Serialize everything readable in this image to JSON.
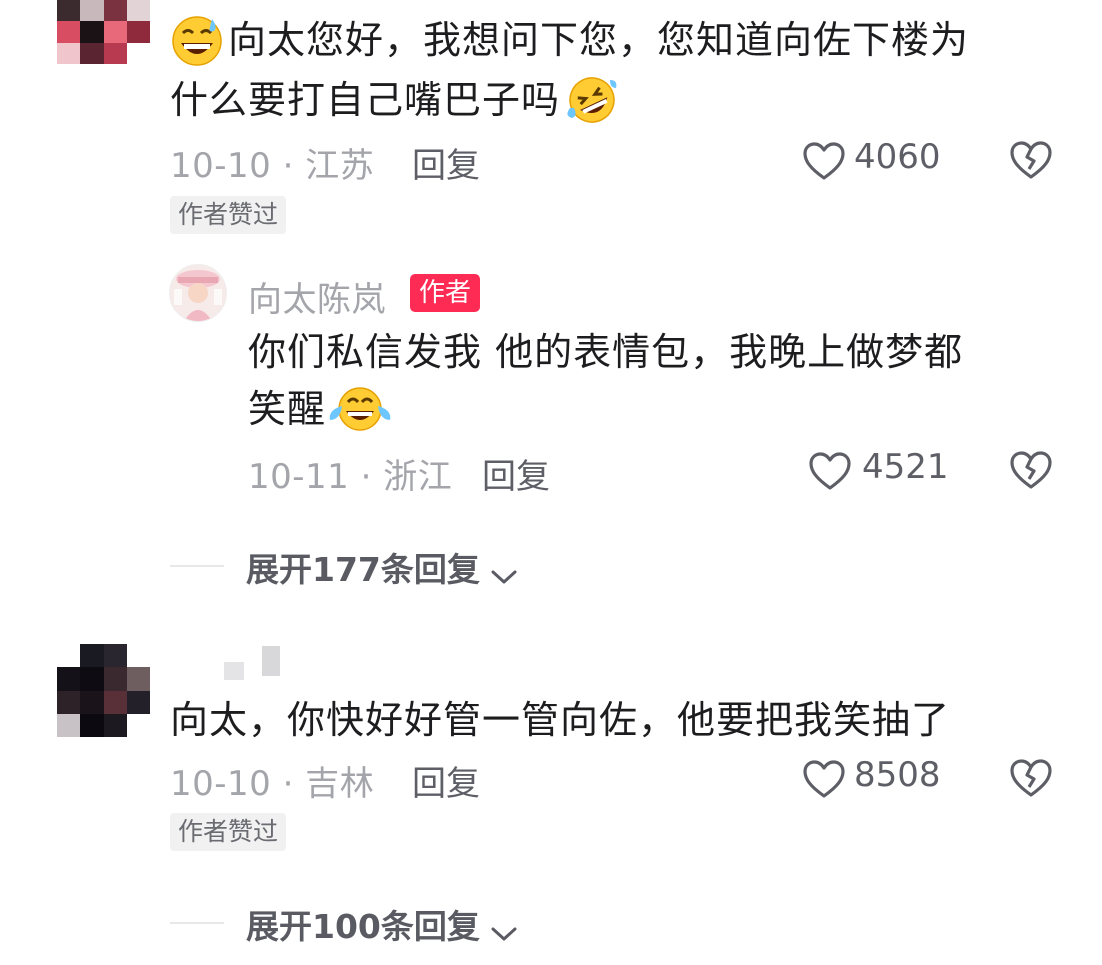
{
  "comments": [
    {
      "text_line1": "向太您好，我想问下您，您知道向佐下楼为",
      "text_line2": "什么要打自己嘴巴子吗",
      "date_location": "10-10 · 江苏",
      "reply_label": "回复",
      "likes": "4060",
      "tag": "作者赞过",
      "reply": {
        "username": "向太陈岚",
        "badge": "作者",
        "text_line1": "你们私信发我  他的表情包，我晚上做梦都",
        "text_line2": "笑醒",
        "date_location": "10-11 · 浙江",
        "reply_label": "回复",
        "likes": "4521"
      },
      "expand_label": "展开177条回复"
    },
    {
      "text_line1": "向太，你快好好管一管向佐，他要把我笑抽了",
      "date_location": "10-10 · 吉林",
      "reply_label": "回复",
      "likes": "8508",
      "tag": "作者赞过",
      "expand_label": "展开100条回复"
    }
  ],
  "colors": {
    "accent": "#fe2c55",
    "meta": "#a4a5ab",
    "text": "#1d1d1f"
  },
  "icons": [
    "heart-outline-icon",
    "broken-heart-icon",
    "chevron-down-icon",
    "grinning-sweat-emoji",
    "rofl-emoji",
    "tears-of-joy-emoji"
  ]
}
